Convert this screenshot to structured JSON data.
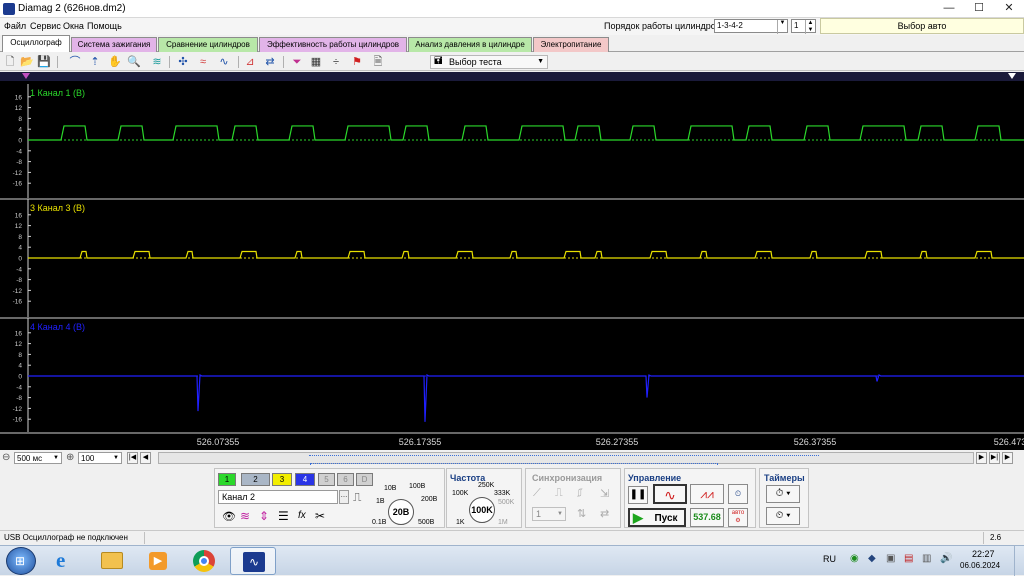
{
  "window": {
    "title": "Diamag 2 (626нов.dm2)",
    "minimize": "—",
    "maximize": "☐",
    "close": "✕"
  },
  "menu": [
    "Файл",
    "Сервис",
    "Окна",
    "Помощь"
  ],
  "header": {
    "cylinder_order_label": "Порядок работы цилиндров",
    "cylinder_order_value": "1-3-4-2",
    "cylinder_value": "1",
    "auto_select": "Выбор авто"
  },
  "tabs": [
    {
      "label": "Осциллограф",
      "color": "#ffffff"
    },
    {
      "label": "Система зажигания",
      "color": "#e2b4e8"
    },
    {
      "label": "Сравнение цилиндров",
      "color": "#b8e8a8"
    },
    {
      "label": "Эффективность работы цилиндров",
      "color": "#e2b4e8"
    },
    {
      "label": "Анализ давления в цилиндре",
      "color": "#b8e8a8"
    },
    {
      "label": "Электропитание",
      "color": "#f3c8c8"
    }
  ],
  "toolbar": {
    "test_select": "Выбор теста"
  },
  "scope": {
    "channels": [
      {
        "label": "1 Канал 1 (В)",
        "color": "#2bd82b"
      },
      {
        "label": "3 Канал 3 (В)",
        "color": "#e8e000"
      },
      {
        "label": "4 Канал 4 (В)",
        "color": "#2020ff"
      }
    ],
    "y_ticks": [
      "16",
      "12",
      "8",
      "4",
      "0",
      "-4",
      "-8",
      "-12",
      "-16"
    ],
    "x_ticks": [
      "526.07355",
      "526.17355",
      "526.27355",
      "526.37355",
      "526.473"
    ]
  },
  "timebar": {
    "timebase": "500 мс",
    "zoom": "100"
  },
  "panel": {
    "channel_buttons": [
      {
        "label": "1",
        "color": "#2bd82b"
      },
      {
        "label": "2",
        "color": "#a9b6c6"
      },
      {
        "label": "3",
        "color": "#f2ee00"
      },
      {
        "label": "4",
        "color": "#2a35e6"
      },
      {
        "label": "5",
        "color": "#d0d0d0"
      },
      {
        "label": "6",
        "color": "#d0d0d0"
      },
      {
        "label": "D",
        "color": "#d0d0d0"
      }
    ],
    "channel_name": "Канал 2",
    "voltage_knob": "20В",
    "voltage_ticks": [
      "10В",
      "100В",
      "1В",
      "200В",
      "0.1В",
      "500В"
    ],
    "frequency_title": "Частота",
    "frequency_knob": "100K",
    "frequency_ticks": [
      "250K",
      "100K",
      "333K",
      "500K",
      "1K",
      "1M"
    ],
    "sync_title": "Синхронизация",
    "sync_value": "1",
    "control_title": "Управление",
    "start_label": "Пуск",
    "rpm_value": "537.68",
    "auto_label": "авто",
    "timers_title": "Таймеры"
  },
  "status": {
    "text": "USB Осциллограф не подключен",
    "right_value": "2.6"
  },
  "taskbar": {
    "language": "RU",
    "time": "22:27",
    "date": "06.06.2024"
  }
}
